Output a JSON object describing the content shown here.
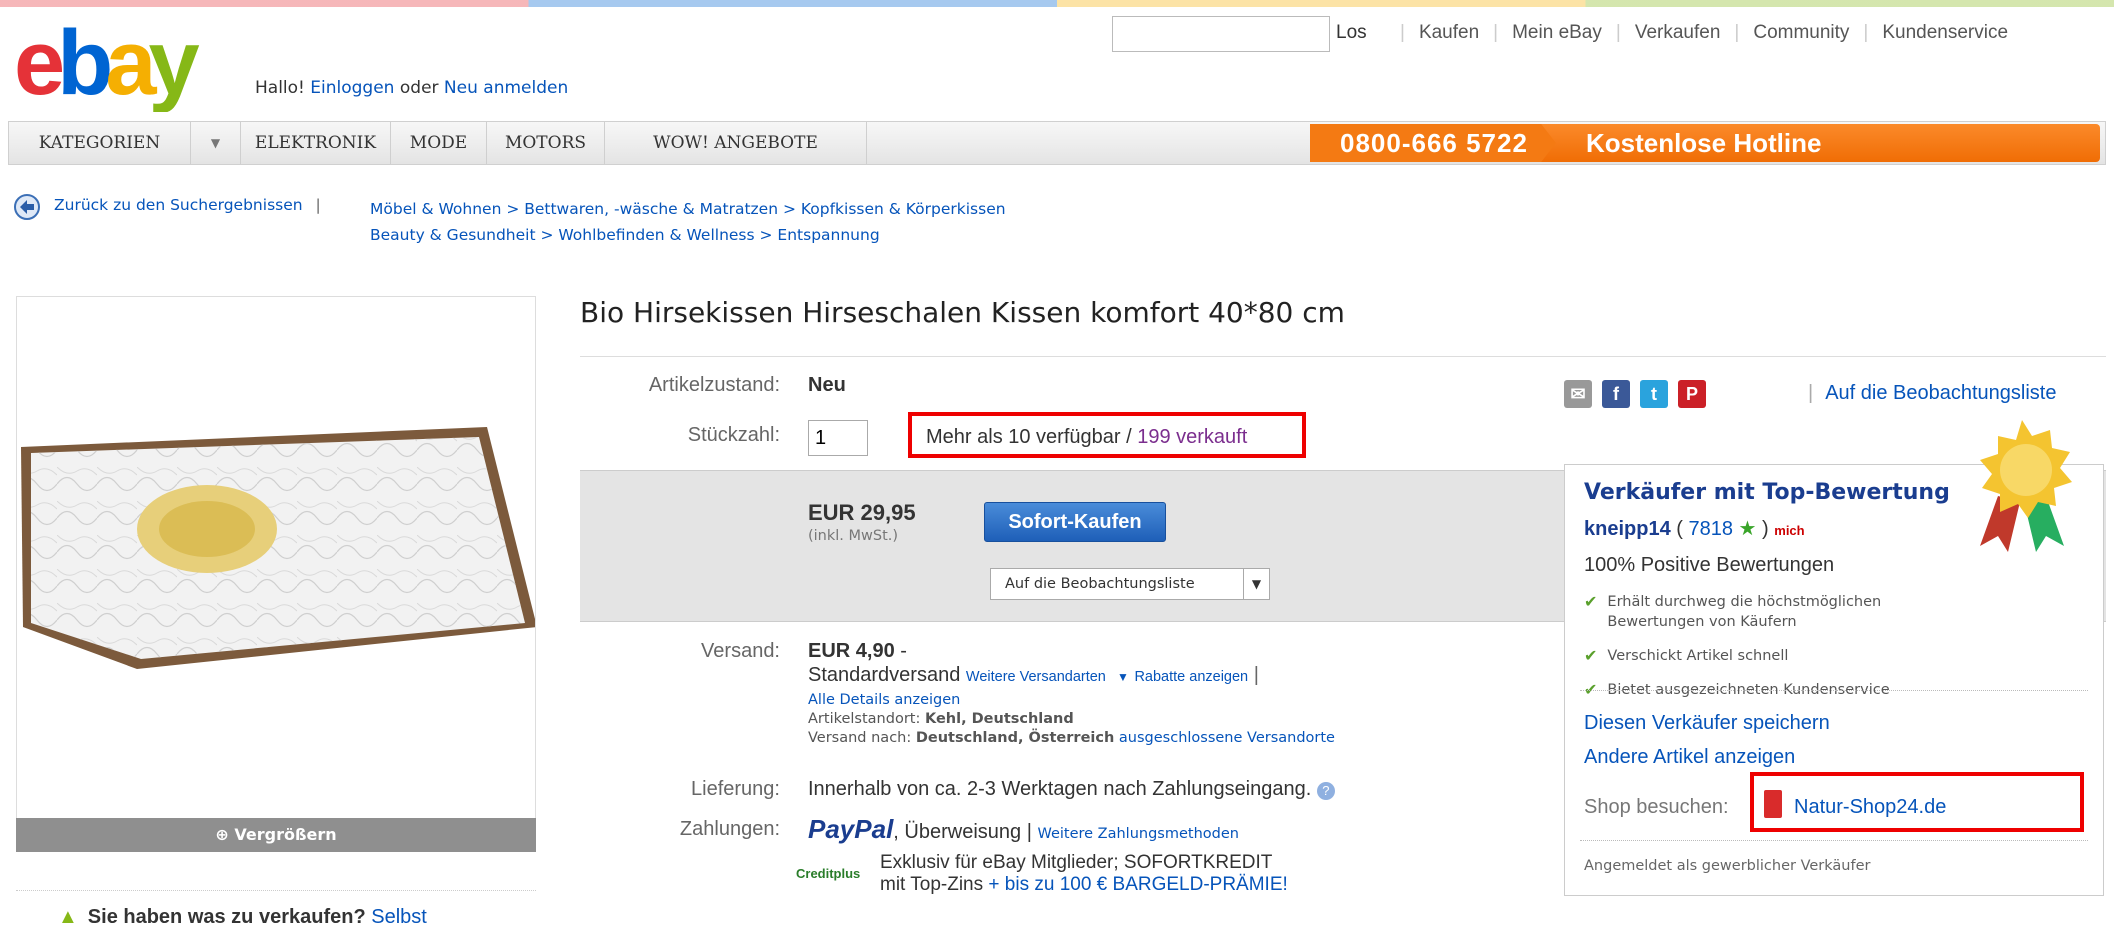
{
  "header": {
    "greeting_prefix": "Hallo! ",
    "login_link": "Einloggen",
    "or_text": " oder ",
    "register_link": "Neu anmelden",
    "search_placeholder": "",
    "search_button": "Los",
    "nav": [
      "Kaufen",
      "Mein eBay",
      "Verkaufen",
      "Community",
      "Kundenservice"
    ]
  },
  "categories": {
    "items": [
      "KATEGORIEN",
      "ELEKTRONIK",
      "MODE",
      "MOTORS",
      "WOW! ANGEBOTE"
    ],
    "hotline_number": "0800-666 5722",
    "hotline_label": "Kostenlose Hotline"
  },
  "breadcrumb": {
    "back_link": "Zurück zu den Suchergebnissen",
    "sep": "|",
    "path1": "Möbel & Wohnen > Bettwaren, -wäsche & Matratzen > Kopfkissen & Körperkissen",
    "path2": "Beauty & Gesundheit > Wohlbefinden & Wellness > Entspannung"
  },
  "product": {
    "title": "Bio Hirsekissen Hirseschalen Kissen komfort 40*80 cm",
    "enlarge_label": "Vergrößern",
    "condition_label": "Artikelzustand:",
    "condition_value": "Neu",
    "quantity_label": "Stückzahl:",
    "quantity_value": "1",
    "availability": "Mehr als 10 verfügbar / ",
    "sold": "199 verkauft",
    "price": "EUR 29,95",
    "price_note": "(inkl. MwSt.)",
    "buy_button": "Sofort-Kaufen",
    "watch_dropdown": "Auf die Beobachtungsliste",
    "shipping_label": "Versand:",
    "shipping_price": "EUR 4,90",
    "shipping_dash": "-",
    "shipping_method": "Standardversand",
    "more_shipping": "Weitere Versandarten",
    "discounts": "Rabatte anzeigen",
    "all_details": "Alle Details anzeigen",
    "location_label": "Artikelstandort:",
    "location_value": "Kehl, Deutschland",
    "ship_to_label": "Versand nach:",
    "ship_to_value": "Deutschland, Österreich",
    "excluded": "ausgeschlossene Versandorte",
    "delivery_label": "Lieferung:",
    "delivery_value": "Innerhalb von ca. 2-3 Werktagen nach Zahlungseingang.",
    "payment_label": "Zahlungen:",
    "paypal": "PayPal",
    "payment_other": ", Überweisung | ",
    "more_payment": "Weitere Zahlungsmethoden",
    "credit_logo": "Creditplus",
    "credit_line1": "Exklusiv für eBay Mitglieder; SOFORTKREDIT",
    "credit_line2_a": "mit Top-Zins ",
    "credit_line2_b": "+ bis zu 100 € BARGELD-PRÄMIE!"
  },
  "seller": {
    "watchlist_link": "Auf die Beobachtungsliste",
    "top_rated": "Verkäufer mit Top-Bewertung",
    "name": "kneipp14",
    "score": "7818",
    "mich": "mich",
    "positive": "100% Positive Bewertungen",
    "bullets": [
      "Erhält durchweg die höchstmöglichen Bewertungen von Käufern",
      "Verschickt Artikel schnell",
      "Bietet ausgezeichneten Kundenservice"
    ],
    "save_seller": "Diesen Verkäufer speichern",
    "other_items": "Andere Artikel anzeigen",
    "shop_label": "Shop besuchen:",
    "shop_name": "Natur-Shop24.de",
    "registered": "Angemeldet als gewerblicher Verkäufer"
  },
  "footer": {
    "sell_text": "Sie haben was zu verkaufen?",
    "sell_link": "Selbst"
  }
}
